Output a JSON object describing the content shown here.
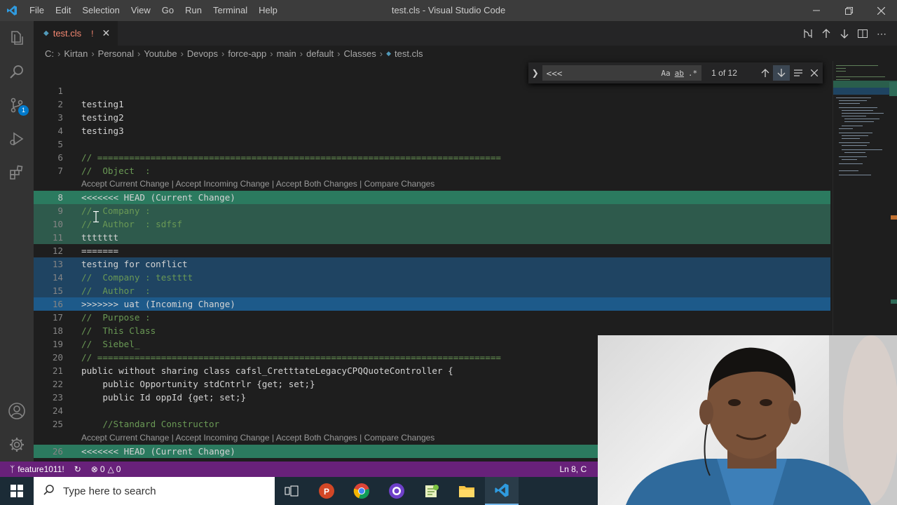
{
  "window": {
    "title": "test.cls - Visual Studio Code",
    "menu": [
      "File",
      "Edit",
      "Selection",
      "View",
      "Go",
      "Run",
      "Terminal",
      "Help"
    ]
  },
  "activity": {
    "scm_badge": "1"
  },
  "tab": {
    "filename": "test.cls",
    "modified_marker": "!"
  },
  "breadcrumb": [
    "C:",
    "Kirtan",
    "Personal",
    "Youtube",
    "Devops",
    "force-app",
    "main",
    "default",
    "Classes",
    "test.cls"
  ],
  "find": {
    "query": "<<<",
    "case_label": "Aa",
    "word_label": "ab",
    "regex_label": ".*",
    "result": "1 of 12"
  },
  "codelens": "Accept Current Change | Accept Incoming Change | Accept Both Changes | Compare Changes",
  "lines": [
    {
      "n": "1",
      "text": ""
    },
    {
      "n": "2",
      "text": "testing1"
    },
    {
      "n": "3",
      "text": "testing2"
    },
    {
      "n": "4",
      "text": "testing3"
    },
    {
      "n": "5",
      "text": ""
    },
    {
      "n": "6",
      "text": "// ============================================================================"
    },
    {
      "n": "7",
      "text": "//  Object  :"
    },
    {
      "n": "8",
      "text": "<<<<<<< HEAD (Current Change)"
    },
    {
      "n": "9",
      "text": "//  Company :"
    },
    {
      "n": "10",
      "text": "//  Author  : sdfsf"
    },
    {
      "n": "11",
      "text": "ttttttt"
    },
    {
      "n": "12",
      "text": "======="
    },
    {
      "n": "13",
      "text": "testing for conflict"
    },
    {
      "n": "14",
      "text": "//  Company : testttt"
    },
    {
      "n": "15",
      "text": "//  Author  :"
    },
    {
      "n": "16",
      "text": ">>>>>>> uat (Incoming Change)"
    },
    {
      "n": "17",
      "text": "//  Purpose :"
    },
    {
      "n": "18",
      "text": "//  This Class"
    },
    {
      "n": "19",
      "text": "//  Siebel_"
    },
    {
      "n": "20",
      "text": "// ============================================================================"
    },
    {
      "n": "21",
      "text": "public without sharing class cafsl_CretttateLegacyCPQQuoteController {"
    },
    {
      "n": "22",
      "text": "    public Opportunity stdCntrlr {get; set;}"
    },
    {
      "n": "23",
      "text": "    public Id oppId {get; set;}"
    },
    {
      "n": "24",
      "text": ""
    },
    {
      "n": "25",
      "text": "    //Standard Constructor"
    },
    {
      "n": "26",
      "text": "<<<<<<< HEAD (Current Change)"
    }
  ],
  "status": {
    "branch": "feature1011!",
    "errors": "0",
    "warnings": "0",
    "position": "Ln 8, C"
  },
  "taskbar": {
    "search_placeholder": "Type here to search"
  }
}
